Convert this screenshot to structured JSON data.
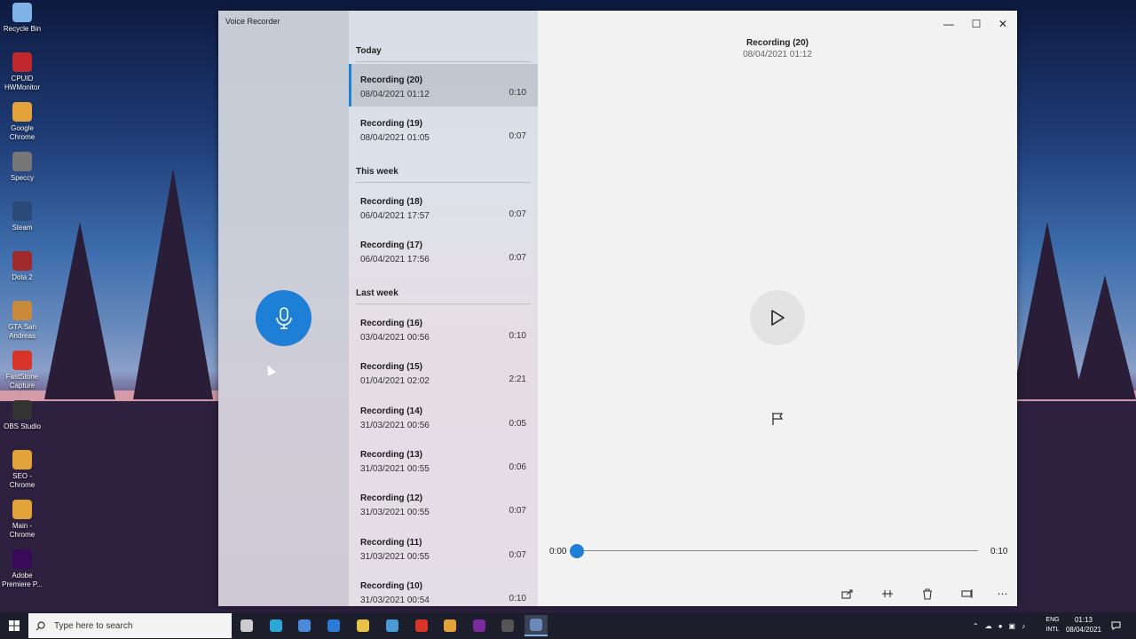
{
  "desktop": {
    "icons": [
      {
        "label": "Recycle Bin",
        "color": "#7fb2e6"
      },
      {
        "label": "CPUID HWMonitor",
        "color": "#c0282e"
      },
      {
        "label": "Google Chrome",
        "color": "#e2a33b"
      },
      {
        "label": "Speccy",
        "color": "#777777"
      },
      {
        "label": "Steam",
        "color": "#2a4b78"
      },
      {
        "label": "Dota 2",
        "color": "#a02a2a"
      },
      {
        "label": "GTA San Andreas",
        "color": "#c88a3a"
      },
      {
        "label": "FastStone Capture",
        "color": "#d8342a"
      },
      {
        "label": "OBS Studio",
        "color": "#333333"
      },
      {
        "label": "SEO - Chrome",
        "color": "#e2a33b"
      },
      {
        "label": "Main - Chrome",
        "color": "#e2a33b"
      },
      {
        "label": "Adobe Premiere P...",
        "color": "#3a0a5a"
      }
    ]
  },
  "window": {
    "app_title": "Voice Recorder",
    "groups": [
      {
        "header": "Today",
        "items": [
          {
            "name": "Recording (20)",
            "date": "08/04/2021 01:12",
            "duration": "0:10",
            "selected": true
          },
          {
            "name": "Recording (19)",
            "date": "08/04/2021 01:05",
            "duration": "0:07",
            "selected": false
          }
        ]
      },
      {
        "header": "This week",
        "items": [
          {
            "name": "Recording (18)",
            "date": "06/04/2021 17:57",
            "duration": "0:07",
            "selected": false
          },
          {
            "name": "Recording (17)",
            "date": "06/04/2021 17:56",
            "duration": "0:07",
            "selected": false
          }
        ]
      },
      {
        "header": "Last week",
        "items": [
          {
            "name": "Recording (16)",
            "date": "03/04/2021 00:56",
            "duration": "0:10",
            "selected": false
          },
          {
            "name": "Recording (15)",
            "date": "01/04/2021 02:02",
            "duration": "2:21",
            "selected": false
          },
          {
            "name": "Recording (14)",
            "date": "31/03/2021 00:56",
            "duration": "0:05",
            "selected": false
          },
          {
            "name": "Recording (13)",
            "date": "31/03/2021 00:55",
            "duration": "0:06",
            "selected": false
          },
          {
            "name": "Recording (12)",
            "date": "31/03/2021 00:55",
            "duration": "0:07",
            "selected": false
          },
          {
            "name": "Recording (11)",
            "date": "31/03/2021 00:55",
            "duration": "0:07",
            "selected": false
          },
          {
            "name": "Recording (10)",
            "date": "31/03/2021 00:54",
            "duration": "0:10",
            "selected": false
          }
        ]
      }
    ],
    "player": {
      "title": "Recording (20)",
      "date": "08/04/2021 01:12",
      "position": "0:00",
      "duration": "0:10",
      "progress": 0
    },
    "accent_color": "#1e7fd6"
  },
  "taskbar": {
    "search_placeholder": "Type here to search",
    "apps": [
      {
        "name": "task-view",
        "color": "#cccccc"
      },
      {
        "name": "edge",
        "color": "#2aa6d8"
      },
      {
        "name": "store",
        "color": "#4a8ad8"
      },
      {
        "name": "mail",
        "color": "#2a7ad8"
      },
      {
        "name": "file-explorer",
        "color": "#e8c14a"
      },
      {
        "name": "photos",
        "color": "#4a9ad8"
      },
      {
        "name": "faststone",
        "color": "#d8342a"
      },
      {
        "name": "chrome",
        "color": "#e2a33b"
      },
      {
        "name": "premiere",
        "color": "#7a2a9a"
      },
      {
        "name": "obs",
        "color": "#555555"
      },
      {
        "name": "voice-recorder",
        "color": "#6a8ab8"
      }
    ],
    "lang_line1": "ENG",
    "lang_line2": "INTL",
    "time": "01:13",
    "date": "08/04/2021"
  }
}
